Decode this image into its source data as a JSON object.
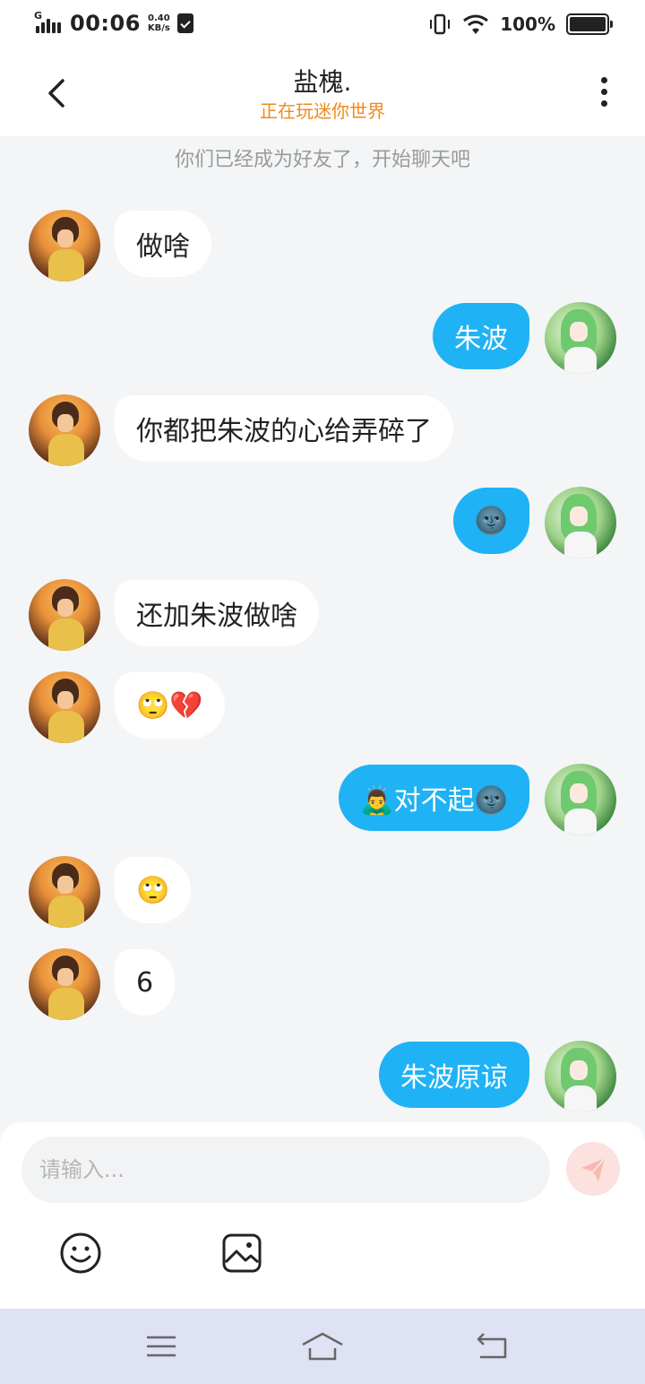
{
  "status_bar": {
    "network_type": "G",
    "time": "00:06",
    "net_speed_value": "0.40",
    "net_speed_unit": "KB/s",
    "battery": "100%"
  },
  "header": {
    "title": "盐槐.",
    "subtitle": "正在玩迷你世界",
    "subtitle_color": "#f08a1c"
  },
  "notice": "你们已经成为好友了，开始聊天吧",
  "messages": [
    {
      "from": "them",
      "text": "做啥"
    },
    {
      "from": "me",
      "text": "朱波"
    },
    {
      "from": "them",
      "text": "你都把朱波的心给弄碎了"
    },
    {
      "from": "me",
      "text": "🌚"
    },
    {
      "from": "them",
      "text": "还加朱波做啥"
    },
    {
      "from": "them",
      "text": "🙄💔"
    },
    {
      "from": "me",
      "text": "🙇‍♂️对不起🌚"
    },
    {
      "from": "them",
      "text": "🙄"
    },
    {
      "from": "them",
      "text": "6"
    },
    {
      "from": "me",
      "text": "朱波原谅"
    }
  ],
  "composer": {
    "placeholder": "请输入...",
    "send_icon": "paper-plane-icon",
    "tools": [
      "smiley-icon",
      "image-icon"
    ]
  },
  "nav_bar": {
    "buttons": [
      "menu-icon",
      "home-icon",
      "back-icon"
    ]
  },
  "colors": {
    "accent": "#1fb2f5",
    "background": "#f3f5f7"
  }
}
